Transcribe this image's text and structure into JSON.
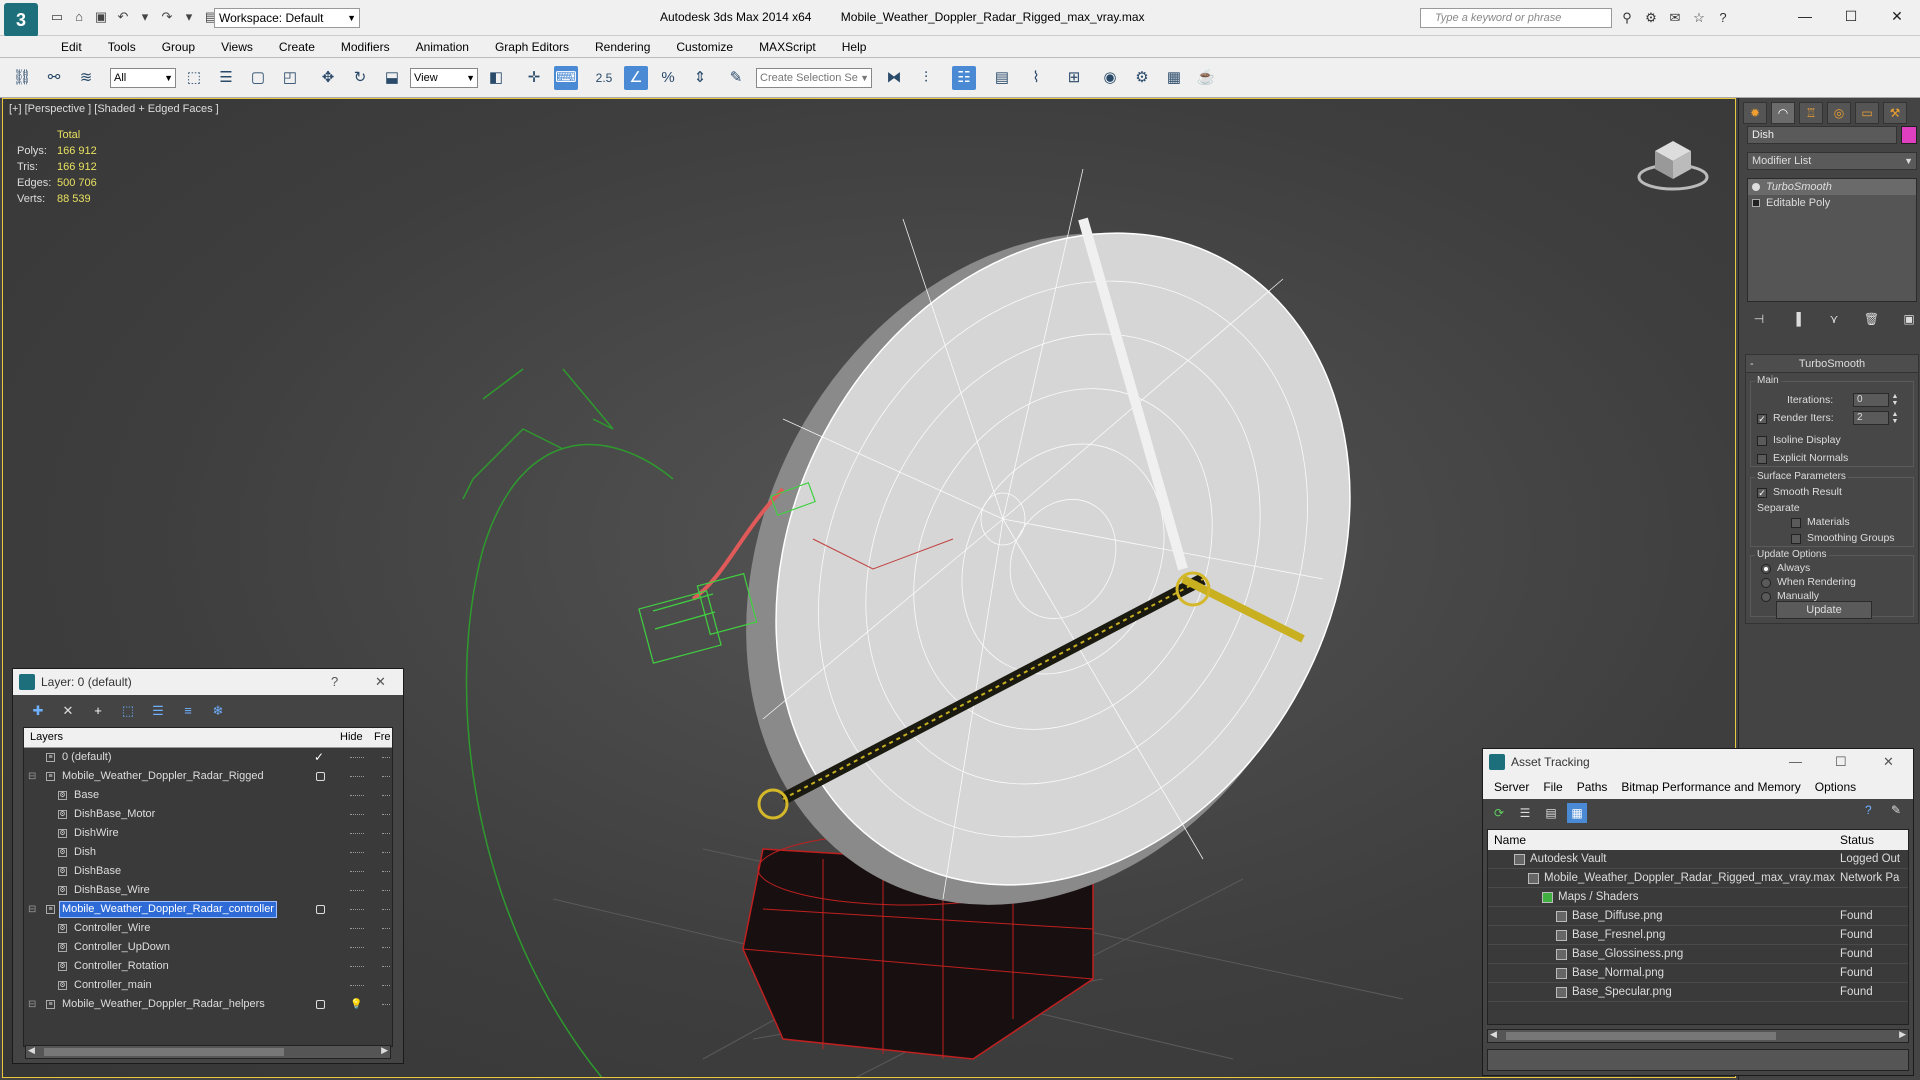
{
  "titlebar": {
    "app": "Autodesk 3ds Max  2014 x64",
    "file": "Mobile_Weather_Doppler_Radar_Rigged_max_vray.max",
    "workspace": "Workspace: Default",
    "search_placeholder": "Type a keyword or phrase"
  },
  "menu": [
    "Edit",
    "Tools",
    "Group",
    "Views",
    "Create",
    "Modifiers",
    "Animation",
    "Graph Editors",
    "Rendering",
    "Customize",
    "MAXScript",
    "Help"
  ],
  "toolbar": {
    "filter_value": "All",
    "refcoord_value": "View",
    "selection_set_value": "Create Selection Se",
    "snap_25": "2.5"
  },
  "viewport": {
    "label": "[+] [Perspective ] [Shaded + Edged Faces ]",
    "stats_header": "Total",
    "stats": [
      {
        "k": "Polys:",
        "v": "166 912"
      },
      {
        "k": "Tris:",
        "v": "166 912"
      },
      {
        "k": "Edges:",
        "v": "500 706"
      },
      {
        "k": "Verts:",
        "v": "88 539"
      }
    ]
  },
  "command_panel": {
    "object_name": "Dish",
    "object_color": "#e040c0",
    "modifier_list": "Modifier List",
    "stack": [
      "TurboSmooth",
      "Editable Poly"
    ],
    "rollout_title": "TurboSmooth",
    "main_label": "Main",
    "iterations_label": "Iterations:",
    "iterations_value": "0",
    "render_iters_label": "Render Iters:",
    "render_iters_value": "2",
    "isoline_label": "Isoline Display",
    "explicit_normals_label": "Explicit Normals",
    "surface_params_label": "Surface Parameters",
    "smooth_result_label": "Smooth Result",
    "separate_label": "Separate",
    "materials_label": "Materials",
    "smoothing_groups_label": "Smoothing Groups",
    "update_options_label": "Update Options",
    "always_label": "Always",
    "when_rendering_label": "When Rendering",
    "manually_label": "Manually",
    "update_button": "Update"
  },
  "layer_window": {
    "title": "Layer: 0 (default)",
    "help": "?",
    "col_layers": "Layers",
    "col_hide": "Hide",
    "col_freeze": "Fre",
    "rows": [
      {
        "name": "0 (default)",
        "level": 0,
        "kind": "layer",
        "check": true
      },
      {
        "name": "Mobile_Weather_Doppler_Radar_Rigged",
        "level": 0,
        "kind": "layer",
        "box": true,
        "expand": true
      },
      {
        "name": "Base",
        "level": 1,
        "kind": "obj"
      },
      {
        "name": "DishBase_Motor",
        "level": 1,
        "kind": "obj"
      },
      {
        "name": "DishWire",
        "level": 1,
        "kind": "obj"
      },
      {
        "name": "Dish",
        "level": 1,
        "kind": "obj"
      },
      {
        "name": "DishBase",
        "level": 1,
        "kind": "obj"
      },
      {
        "name": "DishBase_Wire",
        "level": 1,
        "kind": "obj"
      },
      {
        "name": "Mobile_Weather_Doppler_Radar_controller",
        "level": 0,
        "kind": "layer",
        "box": true,
        "expand": true,
        "selected": true
      },
      {
        "name": "Controller_Wire",
        "level": 1,
        "kind": "obj"
      },
      {
        "name": "Controller_UpDown",
        "level": 1,
        "kind": "obj"
      },
      {
        "name": "Controller_Rotation",
        "level": 1,
        "kind": "obj"
      },
      {
        "name": "Controller_main",
        "level": 1,
        "kind": "obj"
      },
      {
        "name": "Mobile_Weather_Doppler_Radar_helpers",
        "level": 0,
        "kind": "layer",
        "box": true,
        "expand": true,
        "bulb": true
      }
    ]
  },
  "asset_window": {
    "title": "Asset Tracking",
    "menu": [
      "Server",
      "File",
      "Paths",
      "Bitmap Performance and Memory",
      "Options"
    ],
    "col_name": "Name",
    "col_status": "Status",
    "rows": [
      {
        "name": "Autodesk Vault",
        "level": 1,
        "status": "Logged Out"
      },
      {
        "name": "Mobile_Weather_Doppler_Radar_Rigged_max_vray.max",
        "level": 2,
        "status": "Network Pa"
      },
      {
        "name": "Maps / Shaders",
        "level": 3,
        "status": ""
      },
      {
        "name": "Base_Diffuse.png",
        "level": 4,
        "status": "Found"
      },
      {
        "name": "Base_Fresnel.png",
        "level": 4,
        "status": "Found"
      },
      {
        "name": "Base_Glossiness.png",
        "level": 4,
        "status": "Found"
      },
      {
        "name": "Base_Normal.png",
        "level": 4,
        "status": "Found"
      },
      {
        "name": "Base_Specular.png",
        "level": 4,
        "status": "Found"
      }
    ]
  },
  "colors": {
    "accent": "#4a8ad4",
    "viewport_border": "#e8c840",
    "stats_value": "#e8e060",
    "selection": "#2e6bd6"
  }
}
